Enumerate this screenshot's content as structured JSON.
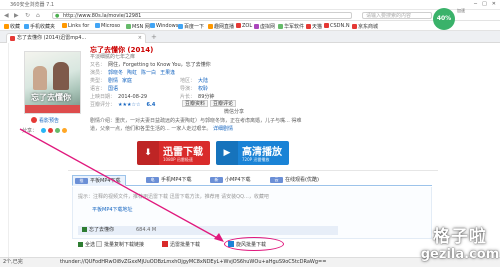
{
  "browser": {
    "title": "360安全浏览器 7.1",
    "url": "http://www.80s.la/movie/12981",
    "search_placeholder": "请输入要搜索的内容",
    "tab_label": "忘了去懂你 (2014)迅雷mp4...",
    "bookmarks": [
      "收藏",
      "手机收藏夹",
      "Links for",
      "Microso",
      "MSN 网",
      "Windows",
      "百度一下",
      "趣网直播",
      "ZOL",
      "虚拟网",
      "华军软件",
      "天猫",
      "CSDN.N",
      "京东商城"
    ],
    "speed": "40%",
    "speed_label": "加速"
  },
  "movie": {
    "title": "忘了去懂你 (2014)",
    "subtitle": "平淡细腻的七年之痒",
    "aka_label": "又名：",
    "aka": "网住，Forgetting to Know You，忘了去懂你",
    "cast_label": "演员：",
    "cast": [
      "郭晓冬",
      "陶虹",
      "陈一白",
      "王果逢"
    ],
    "type_label": "类型：",
    "type": [
      "剧情",
      "家庭"
    ],
    "region_label": "地区：",
    "region": "大陆",
    "language_label": "语言：",
    "language": "国语",
    "director_label": "导演：",
    "director": "权聆",
    "date_label": "上映日期：",
    "date": "2014-08-29",
    "runtime_label": "片长：",
    "runtime": "89分钟",
    "rating_label": "豆瓣评分：",
    "stars": "★★★☆☆",
    "rating": "6.4",
    "douban_btn": "豆瓣资料",
    "comment_btn": "豆瓣评论",
    "wechat_label": "微信分享",
    "desc_label": "剧情介绍：",
    "desc": "重庆，一对夫妻日益疏远的夫妻陶虹）与郭晓冬饰，正在考虑离婚，儿子与嘴... 得难道，父亲一点，他们和各里生活的... 一家人走过艰辛。",
    "desc_more": "详细剧情",
    "poster_title": "忘了去懂你",
    "trailer": "看影预告",
    "share_label": "分享："
  },
  "downloads": {
    "xunlei_label": "迅雷下载",
    "xunlei_sub": "1080P 迅雷极速",
    "hd_label": "高清播放",
    "hd_sub": "720P 迅雷播放",
    "formats": [
      {
        "badge": "推",
        "label": "平板MP4下载"
      },
      {
        "badge": "电",
        "label": "手机MP4下载"
      },
      {
        "badge": "新",
        "label": "小MP4下载"
      },
      {
        "badge": "云",
        "label": "在线观看(优酷)"
      }
    ],
    "hint": "提示：注释的视频文件，推荐用迅雷下载 迅雷下载方法，推荐用 请安装QQ...，收藏吧",
    "direct_link": "平板MP4下载地址",
    "file_name": "忘了去懂你",
    "file_size": "684.4 M",
    "select_all": "全选",
    "batch_copy": "批量复制下载链接",
    "thunder_batch": "迅雷批量下载",
    "xuanfeng_batch": "旋风批量下载"
  },
  "status": {
    "left1": "2个,已完",
    "left2": "thunder://QUFodHRwOi8vZG...",
    "link": "thunder://QUFodHRwOi8vZGxxMjUuODBzLmxhOjgyMC8xNDEyL+WvjOS6huWOu+aHguS9oC5tcDRaWg=="
  },
  "watermark": {
    "cn": "格子啦",
    "en": "gezila.com"
  }
}
